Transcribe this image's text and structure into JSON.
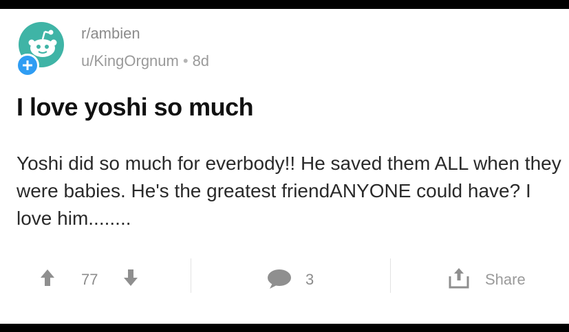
{
  "post": {
    "subreddit": "r/ambien",
    "author": "u/KingOrgnum",
    "separator": "•",
    "age": "8d",
    "title": "I love yoshi so much",
    "body": "Yoshi did so much for everbody!! He saved them ALL when they were babies. He's the greatest friendANYONE could have? I love him........"
  },
  "actions": {
    "score": "77",
    "comments": "3",
    "share_label": "Share"
  },
  "colors": {
    "avatar": "#3fb4a6",
    "plus_badge": "#2f9df3",
    "icon_gray": "#8f8f8f"
  },
  "icons": {
    "avatar": "reddit-snoo-icon",
    "badge": "plus-icon",
    "upvote": "arrow-up-icon",
    "downvote": "arrow-down-icon",
    "comment": "speech-bubble-icon",
    "share": "share-upload-icon"
  }
}
